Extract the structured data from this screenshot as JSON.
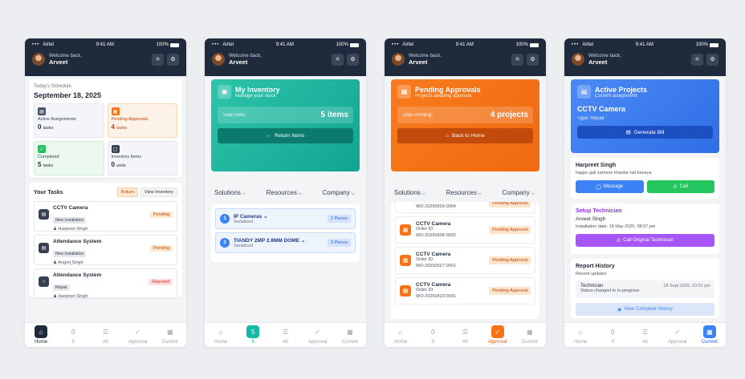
{
  "status": {
    "carrier": "Airtel",
    "time": "9:41 AM",
    "battery": "100%"
  },
  "welcome": {
    "greeting": "Welcome back,",
    "name": "Arveet"
  },
  "nav": {
    "home": "Home",
    "count": "0",
    "count_active": "5",
    "all": "All",
    "approval": "Approval",
    "current": "Current"
  },
  "home": {
    "schedule_label": "Today's Schedule",
    "date": "September 18, 2025",
    "tiles": [
      {
        "title": "Active Assignments",
        "value": "0",
        "unit": "tasks"
      },
      {
        "title": "Pending Approvals",
        "value": "4",
        "unit": "tasks"
      },
      {
        "title": "Completed",
        "value": "5",
        "unit": "tasks"
      },
      {
        "title": "Inventory Items",
        "value": "0",
        "unit": "units"
      }
    ],
    "tasks_title": "Your Tasks",
    "return_label": "Return",
    "view_inventory_label": "View Inventory",
    "tasks": [
      {
        "name": "CCTV Camera",
        "type": "New Installation",
        "person": "Harpreet Singh",
        "status": "Pending"
      },
      {
        "name": "Attendance System",
        "type": "New Installation",
        "person": "Angrej Singh",
        "status": "Pending"
      },
      {
        "name": "Attendance System",
        "type": "Repair",
        "person": "Harpreet Singh",
        "status": "Rejected"
      }
    ]
  },
  "inventory": {
    "title": "My Inventory",
    "subtitle": "Manage your stock",
    "total_label": "Total Units:",
    "total_value": "5 items",
    "button": "Return Items",
    "items": [
      {
        "num": "1",
        "name": "IP Cameras",
        "sub": "Serialized",
        "qty": "2 Pieces"
      },
      {
        "num": "2",
        "name": "TIANDY 2MP 2.8MM DOME",
        "sub": "Serialized",
        "qty": "3 Pieces"
      }
    ]
  },
  "menu": {
    "solutions": "Solutions",
    "resources": "Resources",
    "company": "Company"
  },
  "approvals": {
    "title": "Pending Approvals",
    "subtitle": "Projects awaiting approval",
    "total_label": "Total Pending:",
    "total_value": "4 projects",
    "button": "Back to Home",
    "top_order": "WO-20250609-0004",
    "order_label": "Order ID:",
    "items": [
      {
        "name": "CCTV Camera",
        "order": "WO-20250608-0002",
        "status": "Pending-Approval"
      },
      {
        "name": "CCTV Camera",
        "order": "WO-20250527-0001",
        "status": "Pending-Approval"
      },
      {
        "name": "CCTV Camera",
        "order": "WO-20250423-0001",
        "status": "Pending-Approval"
      }
    ]
  },
  "projects": {
    "title": "Active Projects",
    "subtitle": "Current assignment",
    "project": "CCTV Camera",
    "type": "Type: Repair",
    "button": "Generate Bill",
    "contact_name": "Harpreet Singh",
    "contact_address": "happo gali sahmne khanbe nal baneya",
    "message": "Message",
    "call": "Call",
    "setup_title": "Setup Technician",
    "tech_name": "Arveet Singh",
    "install_date": "Installation date: 18 May 2025, 08:57 pm",
    "call_original": "Call Original Technician",
    "report_title": "Report History",
    "recent": "Recent updates",
    "history_name": "Technician",
    "history_desc": "Status changed to in-progress",
    "history_time": "18 Sept 2025, 03:51 pm",
    "view_history": "View Complete History"
  }
}
